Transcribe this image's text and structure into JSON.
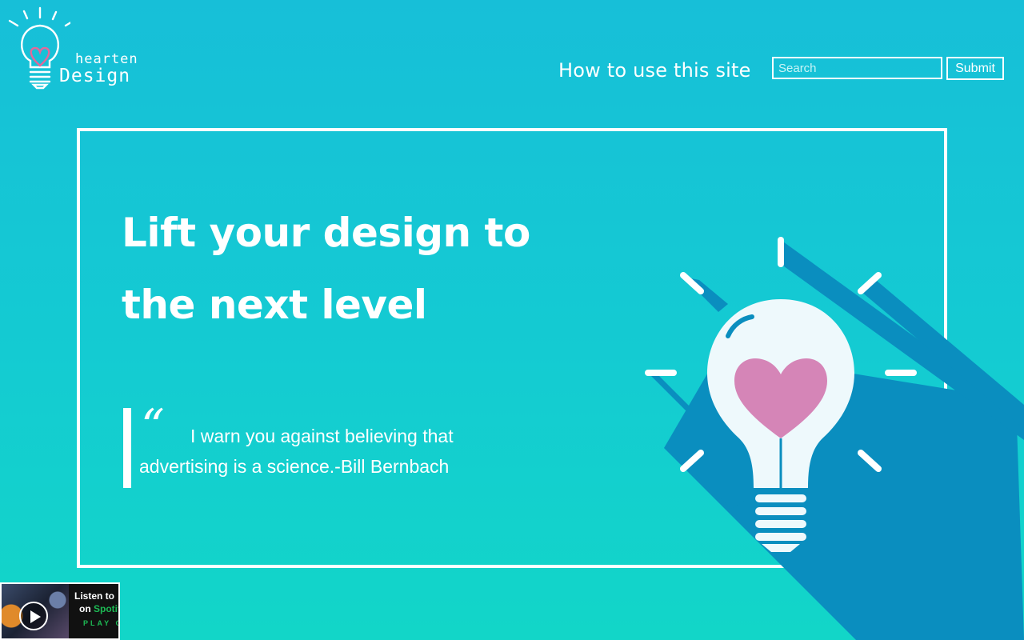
{
  "logo": {
    "word1": "hearten",
    "word2": "Design",
    "icon": "lightbulb-heart-icon",
    "heart_color": "#e0699b"
  },
  "nav": {
    "how_to_use_label": "How to use this site"
  },
  "search": {
    "placeholder": "Search",
    "value": "",
    "submit_label": "Submit"
  },
  "hero": {
    "headline": "Lift your design to the next level",
    "quote_mark": "“",
    "quote": "I warn you against believing that advertising is a science.-Bill Bernbach",
    "illustration": "lightbulb-heart-icon",
    "colors": {
      "background_top": "#17bfd8",
      "background_bottom": "#12d6c8",
      "shadow": "#0a8ebf",
      "bulb": "#eef9fc",
      "heart": "#d585b7"
    }
  },
  "spotify": {
    "line1": "Listen to",
    "line2_prefix": "on ",
    "line2_brand": "Spotify",
    "cta": "PLAY ON",
    "icon": "play-icon",
    "brand_color": "#1db954"
  }
}
